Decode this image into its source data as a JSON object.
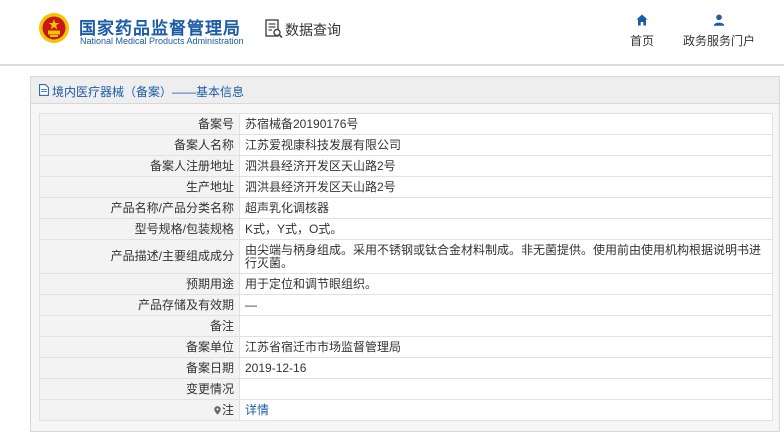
{
  "header": {
    "brand_cn": "国家药品监督管理局",
    "brand_en": "National Medical Products Administration",
    "query_label": "数据查询",
    "nav": [
      {
        "label": "首页",
        "icon": "home-icon"
      },
      {
        "label": "政务服务门户",
        "icon": "user-icon"
      }
    ]
  },
  "panel": {
    "title": "境内医疗器械（备案）——基本信息"
  },
  "record": {
    "rows": [
      {
        "label": "备案号",
        "value": "苏宿械备20190176号"
      },
      {
        "label": "备案人名称",
        "value": "江苏爱视康科技发展有限公司"
      },
      {
        "label": "备案人注册地址",
        "value": "泗洪县经济开发区天山路2号"
      },
      {
        "label": "生产地址",
        "value": "泗洪县经济开发区天山路2号"
      },
      {
        "label": "产品名称/产品分类名称",
        "value": "超声乳化调核器"
      },
      {
        "label": "型号规格/包装规格",
        "value": "K式，Y式，O式。"
      },
      {
        "label": "产品描述/主要组成成分",
        "value": "由尖端与柄身组成。采用不锈钢或钛合金材料制成。非无菌提供。使用前由使用机构根据说明书进行灭菌。"
      },
      {
        "label": "预期用途",
        "value": "用于定位和调节眼组织。"
      },
      {
        "label": "产品存储及有效期",
        "value": "—"
      },
      {
        "label": "备注",
        "value": ""
      },
      {
        "label": "备案单位",
        "value": "江苏省宿迁市市场监督管理局"
      },
      {
        "label": "备案日期",
        "value": "2019-12-16"
      },
      {
        "label": "变更情况",
        "value": ""
      },
      {
        "label": "注",
        "value": "详情"
      }
    ]
  },
  "colors": {
    "brand_blue": "#1c5ca6",
    "label_bg": "#f3f3f3",
    "border": "#e1e1e1",
    "emblem_red": "#c8161d",
    "emblem_gold": "#f2c500"
  }
}
